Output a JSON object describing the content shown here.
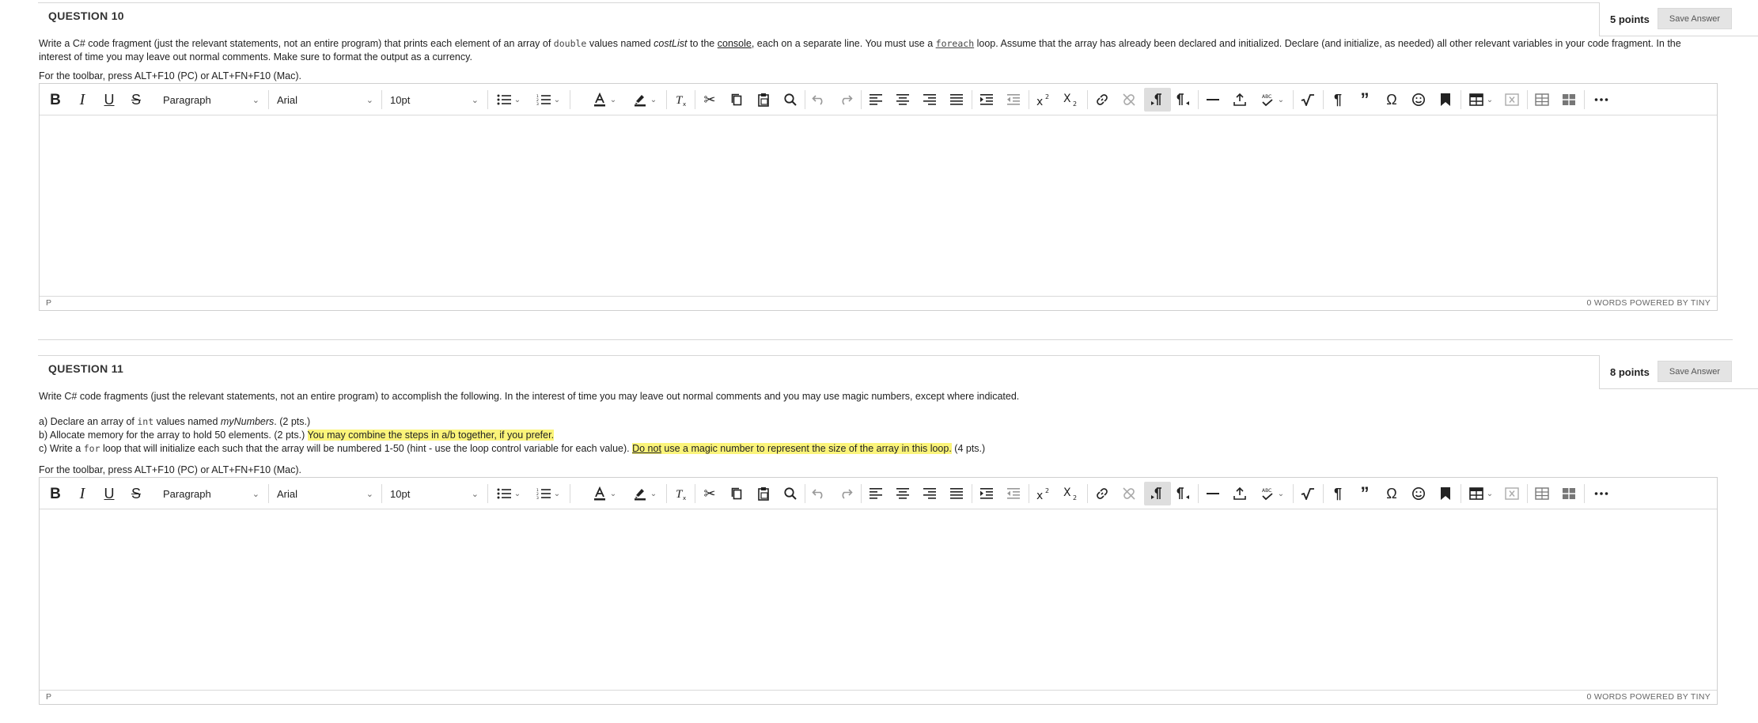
{
  "questions": [
    {
      "title": "QUESTION 10",
      "points": "5 points",
      "save_label": "Save Answer",
      "prompt": {
        "t1": "Write a C# code fragment (just the relevant statements, not an entire program) that prints each element of an array of ",
        "c1": "double",
        "t2": " values named ",
        "e1": "costList",
        "t3": " to the ",
        "u1": "console",
        "t4": ", each on a separate line. You must use a ",
        "c2": "foreach",
        "t5": " loop. Assume that the array has already been declared and initialized. Declare (and initialize, as needed) all other relevant variables in your code fragment. In the interest of time you may leave out normal comments. Make sure to format the output as a currency."
      },
      "toolbar_hint": "For the toolbar, press ALT+F10 (PC) or ALT+FN+F10 (Mac).",
      "status_path": "P",
      "status_right": "0 WORDS  POWERED BY TINY"
    },
    {
      "title": "QUESTION 11",
      "points": "8 points",
      "save_label": "Save Answer",
      "intro": "Write C# code fragments (just the relevant statements, not an entire program) to accomplish the following. In the interest of time you may leave out normal comments and you may use magic numbers, except where indicated.",
      "a": {
        "t1": "a) Declare an array of ",
        "c1": "int",
        "t2": " values named ",
        "e1": "myNumbers",
        "t3": ". (2 pts.)"
      },
      "b": {
        "t1": "b) Allocate memory for the array to hold 50 elements. (2 pts.) ",
        "h1": "You may combine the steps in a/b together, if you prefer."
      },
      "c": {
        "t1": "c) Write a ",
        "c1": "for",
        "t2": " loop that will initialize each such that the array will be numbered 1-50 (hint - use the loop control variable for each value). ",
        "h1u": "Do not",
        "h1": " use a magic number to represent the size of the array in this loop.",
        "t3": " (4 pts.)"
      },
      "toolbar_hint": "For the toolbar, press ALT+F10 (PC) or ALT+FN+F10 (Mac).",
      "status_path": "P",
      "status_right": "0 WORDS  POWERED BY TINY"
    }
  ],
  "toolbar": {
    "bold": "B",
    "italic": "I",
    "underline": "U",
    "strikethrough": "S",
    "block_format": "Paragraph",
    "font_family": "Arial",
    "font_size": "10pt",
    "icons": [
      "bullet-list-icon",
      "numbered-list-icon",
      "text-color-icon",
      "highlight-icon",
      "clear-format-icon",
      "cut-icon",
      "copy-icon",
      "paste-icon",
      "find-icon",
      "undo-icon",
      "redo-icon",
      "align-left-icon",
      "align-center-icon",
      "align-right-icon",
      "align-justify-icon",
      "indent-icon",
      "outdent-icon",
      "superscript-icon",
      "subscript-icon",
      "link-icon",
      "unlink-icon",
      "ltr-icon",
      "rtl-icon",
      "horizontal-rule-icon",
      "insert-icon",
      "spellcheck-icon",
      "math-icon",
      "paragraph-mark-icon",
      "blockquote-icon",
      "special-char-icon",
      "emoji-icon",
      "bookmark-icon",
      "table-icon",
      "remove-icon",
      "table-props-icon",
      "table-cells-icon",
      "more-icon"
    ]
  },
  "colors": {
    "highlight": "#fbf47a",
    "active_button": "#dedede",
    "border": "#cfcfcf"
  }
}
